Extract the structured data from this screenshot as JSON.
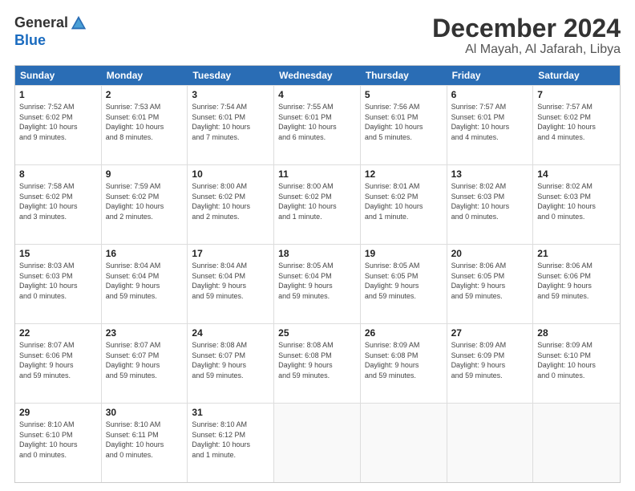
{
  "logo": {
    "line1": "General",
    "line2": "Blue"
  },
  "title": "December 2024",
  "location": "Al Mayah, Al Jafarah, Libya",
  "days_of_week": [
    "Sunday",
    "Monday",
    "Tuesday",
    "Wednesday",
    "Thursday",
    "Friday",
    "Saturday"
  ],
  "weeks": [
    [
      {
        "day": "1",
        "lines": [
          "Sunrise: 7:52 AM",
          "Sunset: 6:02 PM",
          "Daylight: 10 hours",
          "and 9 minutes."
        ]
      },
      {
        "day": "2",
        "lines": [
          "Sunrise: 7:53 AM",
          "Sunset: 6:01 PM",
          "Daylight: 10 hours",
          "and 8 minutes."
        ]
      },
      {
        "day": "3",
        "lines": [
          "Sunrise: 7:54 AM",
          "Sunset: 6:01 PM",
          "Daylight: 10 hours",
          "and 7 minutes."
        ]
      },
      {
        "day": "4",
        "lines": [
          "Sunrise: 7:55 AM",
          "Sunset: 6:01 PM",
          "Daylight: 10 hours",
          "and 6 minutes."
        ]
      },
      {
        "day": "5",
        "lines": [
          "Sunrise: 7:56 AM",
          "Sunset: 6:01 PM",
          "Daylight: 10 hours",
          "and 5 minutes."
        ]
      },
      {
        "day": "6",
        "lines": [
          "Sunrise: 7:57 AM",
          "Sunset: 6:01 PM",
          "Daylight: 10 hours",
          "and 4 minutes."
        ]
      },
      {
        "day": "7",
        "lines": [
          "Sunrise: 7:57 AM",
          "Sunset: 6:02 PM",
          "Daylight: 10 hours",
          "and 4 minutes."
        ]
      }
    ],
    [
      {
        "day": "8",
        "lines": [
          "Sunrise: 7:58 AM",
          "Sunset: 6:02 PM",
          "Daylight: 10 hours",
          "and 3 minutes."
        ]
      },
      {
        "day": "9",
        "lines": [
          "Sunrise: 7:59 AM",
          "Sunset: 6:02 PM",
          "Daylight: 10 hours",
          "and 2 minutes."
        ]
      },
      {
        "day": "10",
        "lines": [
          "Sunrise: 8:00 AM",
          "Sunset: 6:02 PM",
          "Daylight: 10 hours",
          "and 2 minutes."
        ]
      },
      {
        "day": "11",
        "lines": [
          "Sunrise: 8:00 AM",
          "Sunset: 6:02 PM",
          "Daylight: 10 hours",
          "and 1 minute."
        ]
      },
      {
        "day": "12",
        "lines": [
          "Sunrise: 8:01 AM",
          "Sunset: 6:02 PM",
          "Daylight: 10 hours",
          "and 1 minute."
        ]
      },
      {
        "day": "13",
        "lines": [
          "Sunrise: 8:02 AM",
          "Sunset: 6:03 PM",
          "Daylight: 10 hours",
          "and 0 minutes."
        ]
      },
      {
        "day": "14",
        "lines": [
          "Sunrise: 8:02 AM",
          "Sunset: 6:03 PM",
          "Daylight: 10 hours",
          "and 0 minutes."
        ]
      }
    ],
    [
      {
        "day": "15",
        "lines": [
          "Sunrise: 8:03 AM",
          "Sunset: 6:03 PM",
          "Daylight: 10 hours",
          "and 0 minutes."
        ]
      },
      {
        "day": "16",
        "lines": [
          "Sunrise: 8:04 AM",
          "Sunset: 6:04 PM",
          "Daylight: 9 hours",
          "and 59 minutes."
        ]
      },
      {
        "day": "17",
        "lines": [
          "Sunrise: 8:04 AM",
          "Sunset: 6:04 PM",
          "Daylight: 9 hours",
          "and 59 minutes."
        ]
      },
      {
        "day": "18",
        "lines": [
          "Sunrise: 8:05 AM",
          "Sunset: 6:04 PM",
          "Daylight: 9 hours",
          "and 59 minutes."
        ]
      },
      {
        "day": "19",
        "lines": [
          "Sunrise: 8:05 AM",
          "Sunset: 6:05 PM",
          "Daylight: 9 hours",
          "and 59 minutes."
        ]
      },
      {
        "day": "20",
        "lines": [
          "Sunrise: 8:06 AM",
          "Sunset: 6:05 PM",
          "Daylight: 9 hours",
          "and 59 minutes."
        ]
      },
      {
        "day": "21",
        "lines": [
          "Sunrise: 8:06 AM",
          "Sunset: 6:06 PM",
          "Daylight: 9 hours",
          "and 59 minutes."
        ]
      }
    ],
    [
      {
        "day": "22",
        "lines": [
          "Sunrise: 8:07 AM",
          "Sunset: 6:06 PM",
          "Daylight: 9 hours",
          "and 59 minutes."
        ]
      },
      {
        "day": "23",
        "lines": [
          "Sunrise: 8:07 AM",
          "Sunset: 6:07 PM",
          "Daylight: 9 hours",
          "and 59 minutes."
        ]
      },
      {
        "day": "24",
        "lines": [
          "Sunrise: 8:08 AM",
          "Sunset: 6:07 PM",
          "Daylight: 9 hours",
          "and 59 minutes."
        ]
      },
      {
        "day": "25",
        "lines": [
          "Sunrise: 8:08 AM",
          "Sunset: 6:08 PM",
          "Daylight: 9 hours",
          "and 59 minutes."
        ]
      },
      {
        "day": "26",
        "lines": [
          "Sunrise: 8:09 AM",
          "Sunset: 6:08 PM",
          "Daylight: 9 hours",
          "and 59 minutes."
        ]
      },
      {
        "day": "27",
        "lines": [
          "Sunrise: 8:09 AM",
          "Sunset: 6:09 PM",
          "Daylight: 9 hours",
          "and 59 minutes."
        ]
      },
      {
        "day": "28",
        "lines": [
          "Sunrise: 8:09 AM",
          "Sunset: 6:10 PM",
          "Daylight: 10 hours",
          "and 0 minutes."
        ]
      }
    ],
    [
      {
        "day": "29",
        "lines": [
          "Sunrise: 8:10 AM",
          "Sunset: 6:10 PM",
          "Daylight: 10 hours",
          "and 0 minutes."
        ]
      },
      {
        "day": "30",
        "lines": [
          "Sunrise: 8:10 AM",
          "Sunset: 6:11 PM",
          "Daylight: 10 hours",
          "and 0 minutes."
        ]
      },
      {
        "day": "31",
        "lines": [
          "Sunrise: 8:10 AM",
          "Sunset: 6:12 PM",
          "Daylight: 10 hours",
          "and 1 minute."
        ]
      },
      null,
      null,
      null,
      null
    ]
  ]
}
